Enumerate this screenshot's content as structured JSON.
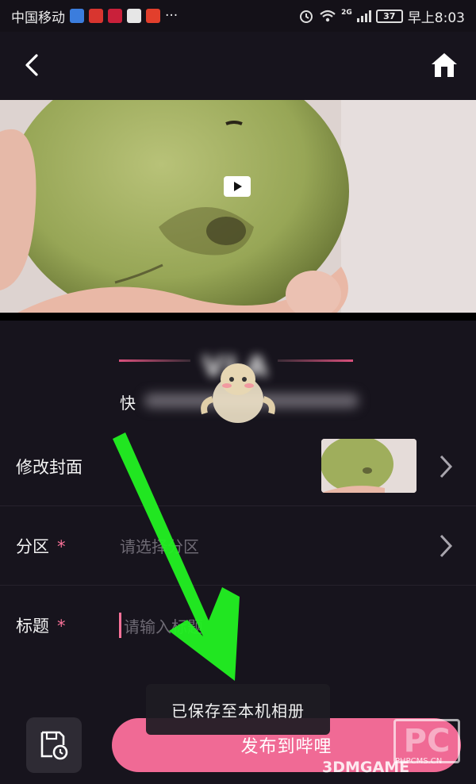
{
  "status_bar": {
    "carrier": "中国移动",
    "dots": "···",
    "network": "2G",
    "battery": "37",
    "time": "早上8:03"
  },
  "form": {
    "quick_prefix": "快",
    "cover_label": "修改封面",
    "category_label": "分区",
    "category_required": "*",
    "category_placeholder": "请选择分区",
    "title_label": "标题",
    "title_required": "*",
    "title_placeholder": "请输入标题"
  },
  "toast": {
    "message": "已保存至本机相册"
  },
  "bottom": {
    "publish_label": "发布到哔哩"
  },
  "watermark": {
    "logo": "PC",
    "url": "PHPCMS.CN",
    "brand": "3DMGAME"
  },
  "colors": {
    "accent": "#fb7299",
    "publish_button": "#f06a95",
    "arrow": "#22f122"
  }
}
